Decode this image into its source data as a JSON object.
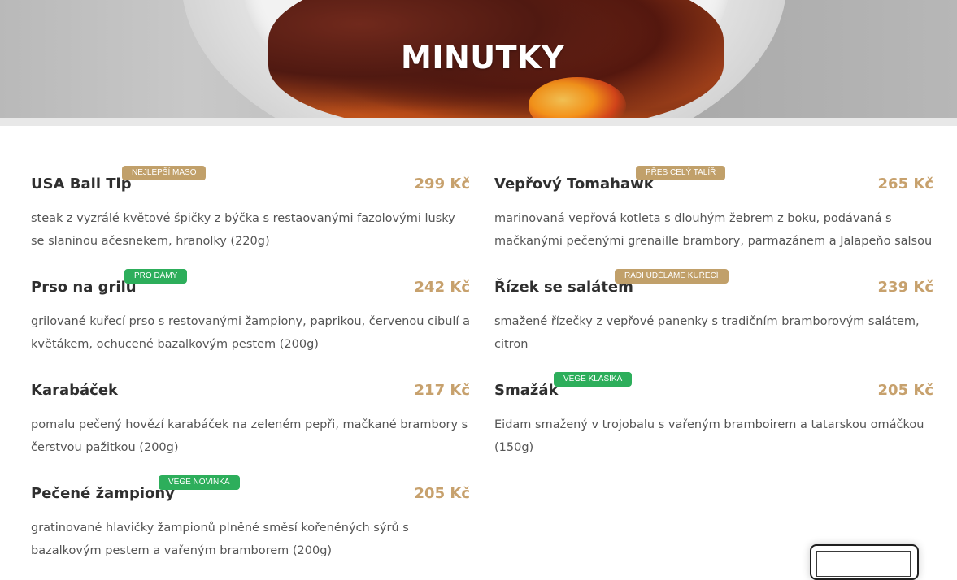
{
  "hero": {
    "title": "MINUTKY"
  },
  "menu": {
    "left": [
      {
        "name": "USA Ball Tip",
        "badge": "NEJLEPŠÍ MASO",
        "badge_color": "gold",
        "price": "299 Kč",
        "description": "steak z vyzrálé květové špičky z býčka s restaovanými fazolovými lusky se slaninou ačesnekem, hranolky (220g)"
      },
      {
        "name": "Prso na grilu",
        "badge": "PRO DÁMY",
        "badge_color": "green",
        "price": "242 Kč",
        "description": "grilované kuřecí prso s restovanými žampiony, paprikou, červenou cibulí a květákem, ochucené bazalkovým pestem (200g)"
      },
      {
        "name": "Karabáček",
        "badge": "",
        "badge_color": "",
        "price": "217 Kč",
        "description": "pomalu pečený hovězí karabáček na zeleném pepři, mačkané brambory s čerstvou pažitkou (200g)"
      },
      {
        "name": "Pečené žampiony",
        "badge": "VEGE NOVINKA",
        "badge_color": "green",
        "price": "205 Kč",
        "description": "gratinované hlavičky žampionů plněné směsí kořeněných sýrů s bazalkovým pestem a vařeným bramborem (200g)"
      }
    ],
    "right": [
      {
        "name": "Vepřový Tomahawk",
        "badge": "PŘES CELÝ TALÍŘ",
        "badge_color": "gold",
        "price": "265 Kč",
        "description": "marinovaná vepřová kotleta s dlouhým žebrem z boku, podávaná s mačkanými pečenými grenaille brambory, parmazánem a Jalapeňo salsou"
      },
      {
        "name": "Řízek se salátem",
        "badge": "RÁDI UDĚLÁME KUŘECÍ",
        "badge_color": "gold",
        "price": "239 Kč",
        "description": "smažené řízečky z vepřové panenky s tradičním bramborovým salátem, citron"
      },
      {
        "name": "Smažák",
        "badge": "VEGE KLASIKA",
        "badge_color": "green",
        "price": "205 Kč",
        "description": "Eidam smažený v trojobalu s vařeným bramboirem a tatarskou omáčkou (150g)"
      }
    ]
  },
  "colors": {
    "price": "#c7a16d",
    "badge_gold": "#c1a06a",
    "badge_green": "#2dae5b",
    "title": "#2f2f2f",
    "description": "#555555"
  }
}
